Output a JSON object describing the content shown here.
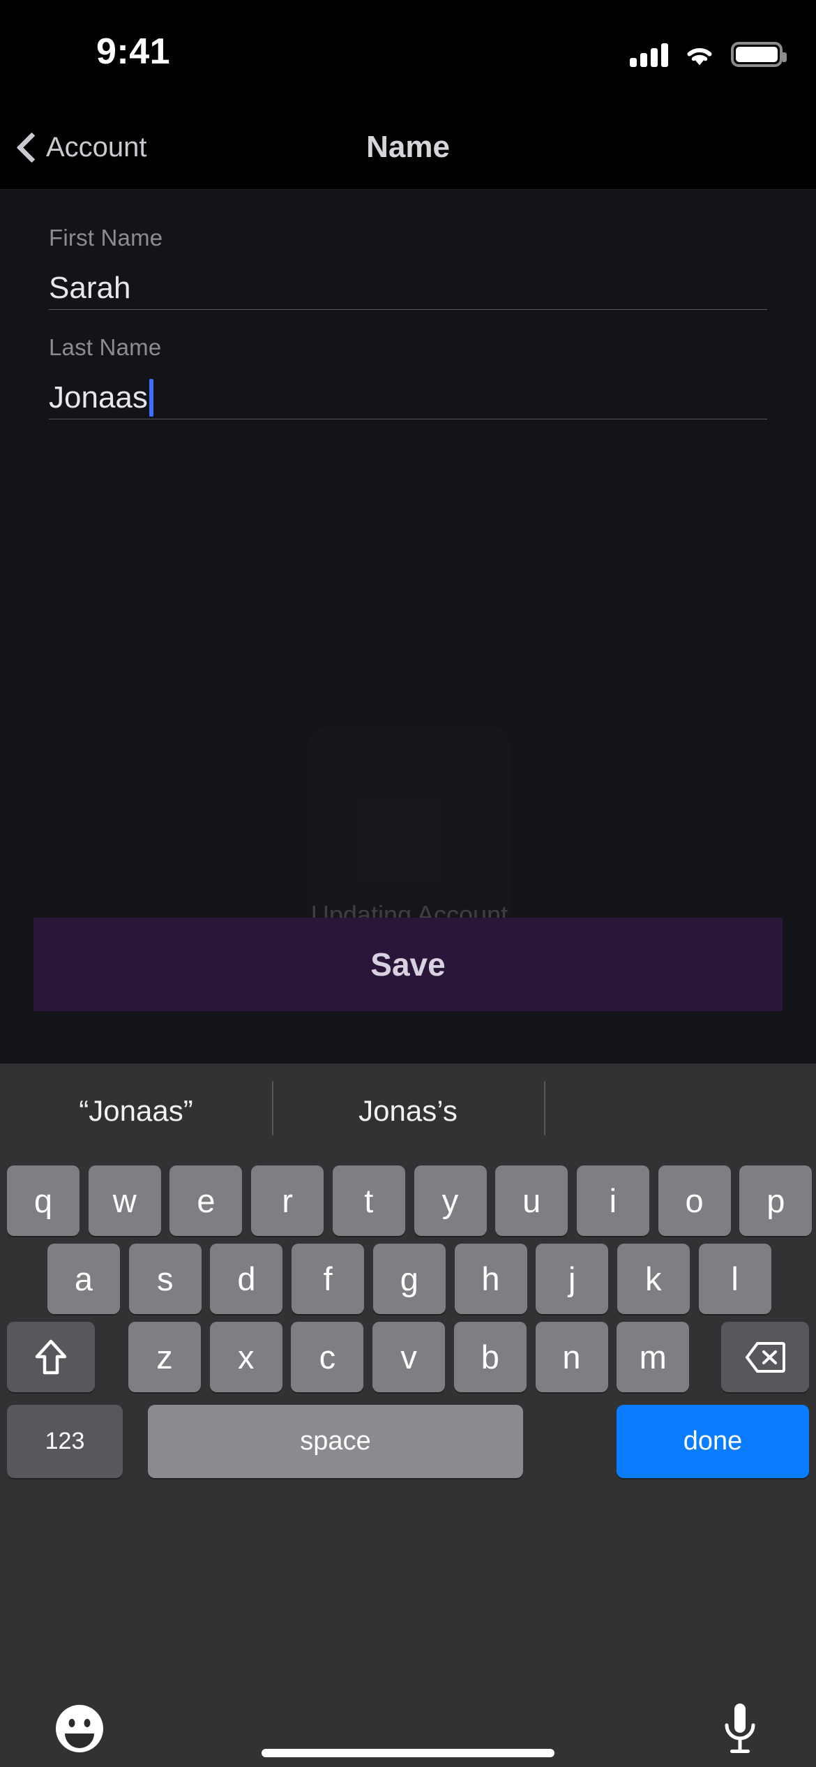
{
  "status_bar": {
    "time": "9:41",
    "cellular_icon": "cellular-signal-icon",
    "wifi_icon": "wifi-icon",
    "battery_icon": "battery-full-icon"
  },
  "nav_bar": {
    "back_label": "Account",
    "back_icon": "chevron-left-icon",
    "title": "Name"
  },
  "form": {
    "fields": [
      {
        "label": "First Name",
        "value": "Sarah",
        "focused": false
      },
      {
        "label": "Last Name",
        "value": "Jonaas",
        "focused": true
      }
    ]
  },
  "overlay": {
    "status_text": "Updating Account",
    "spinner_icon": "loading-spinner-icon"
  },
  "save_button": {
    "label": "Save",
    "background": "#2a1638",
    "text_color": "#d8d2e0"
  },
  "keyboard": {
    "suggestions": [
      "“Jonaas”",
      "Jonas’s",
      ""
    ],
    "row1": [
      "q",
      "w",
      "e",
      "r",
      "t",
      "y",
      "u",
      "i",
      "o",
      "p"
    ],
    "row2": [
      "a",
      "s",
      "d",
      "f",
      "g",
      "h",
      "j",
      "k",
      "l"
    ],
    "row3": [
      "z",
      "x",
      "c",
      "v",
      "b",
      "n",
      "m"
    ],
    "shift_icon": "shift-arrow-icon",
    "backspace_icon": "backspace-delete-icon",
    "numbers_key": "123",
    "space_key": "space",
    "return_key": "done",
    "return_key_color": "#0a7cff",
    "emoji_icon": "emoji-smiley-icon",
    "dictation_icon": "microphone-icon"
  },
  "home_indicator": "home-indicator-bar"
}
